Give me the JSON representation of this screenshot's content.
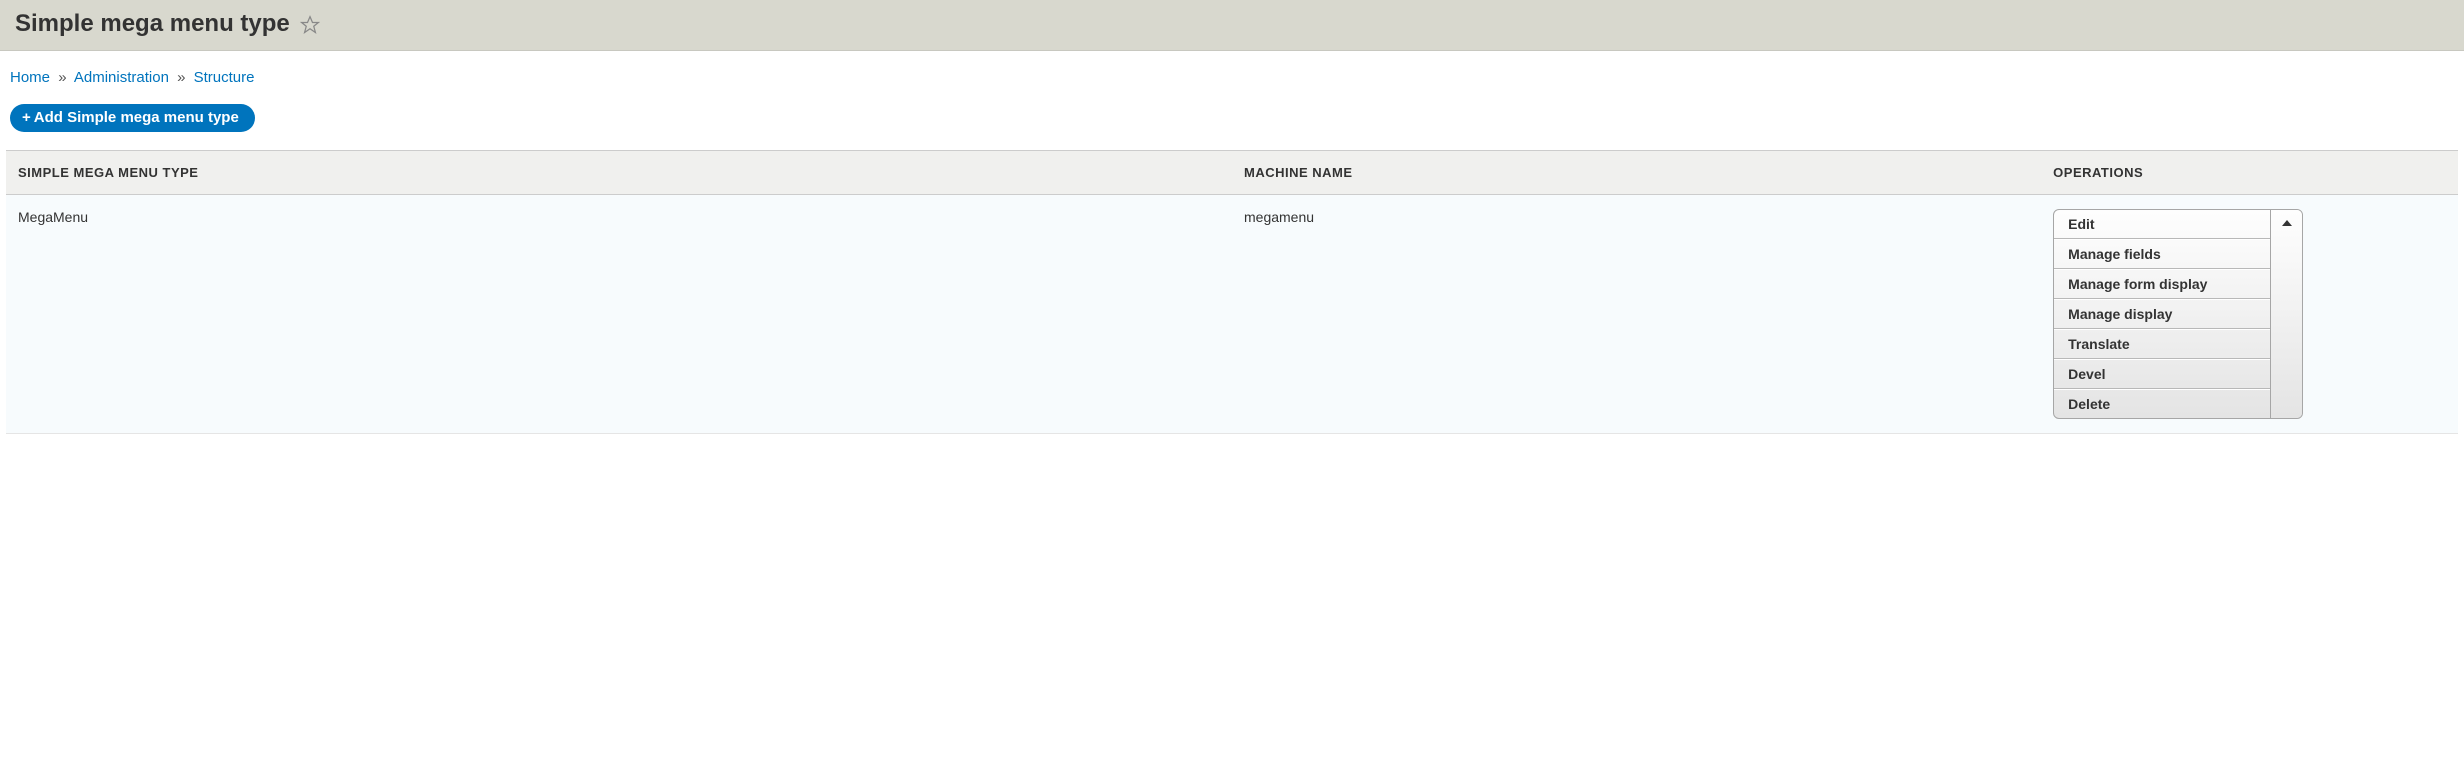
{
  "header": {
    "title": "Simple mega menu type"
  },
  "breadcrumb": {
    "items": [
      {
        "label": "Home"
      },
      {
        "label": "Administration"
      },
      {
        "label": "Structure"
      }
    ],
    "separator": "»"
  },
  "actions": {
    "add_label": "Add Simple mega menu type"
  },
  "table": {
    "columns": {
      "type": "Simple mega menu type",
      "machine": "Machine Name",
      "operations": "Operations"
    },
    "rows": [
      {
        "type_label": "MegaMenu",
        "machine_name": "megamenu",
        "operations": [
          "Edit",
          "Manage fields",
          "Manage form display",
          "Manage display",
          "Translate",
          "Devel",
          "Delete"
        ]
      }
    ]
  }
}
